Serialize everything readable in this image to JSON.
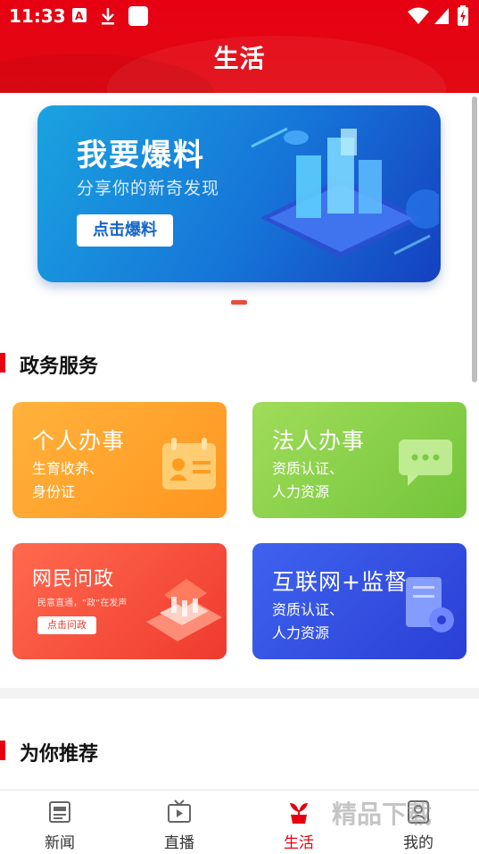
{
  "status_bar": {
    "time": "11:33"
  },
  "header": {
    "title": "生活"
  },
  "banner": {
    "headline": "我要爆料",
    "subline": "分享你的新奇发现",
    "button_label": "点击爆料"
  },
  "sections": {
    "gov": "政务服务",
    "recommend": "为你推荐"
  },
  "cards": [
    {
      "title": "个人办事",
      "sub1": "生育收养、",
      "sub2": "身份证",
      "icon": "id-card-icon"
    },
    {
      "title": "法人办事",
      "sub1": "资质认证、",
      "sub2": "人力资源",
      "icon": "chat-icon"
    },
    {
      "title": "网民问政",
      "small": "民意直通，“政”在发声",
      "mini": "点击问政",
      "icon": "building-icon"
    },
    {
      "title": "互联网+监督",
      "sub1": "资质认证、",
      "sub2": "人力资源",
      "icon": "document-gear-icon"
    }
  ],
  "nav": [
    {
      "label": "新闻",
      "icon": "news-icon"
    },
    {
      "label": "直播",
      "icon": "tv-icon"
    },
    {
      "label": "生活",
      "icon": "plant-icon",
      "active": true
    },
    {
      "label": "我的",
      "icon": "user-icon"
    }
  ],
  "watermark": "精品下载",
  "colors": {
    "brand": "#e60012",
    "active_nav": "#e60012"
  }
}
